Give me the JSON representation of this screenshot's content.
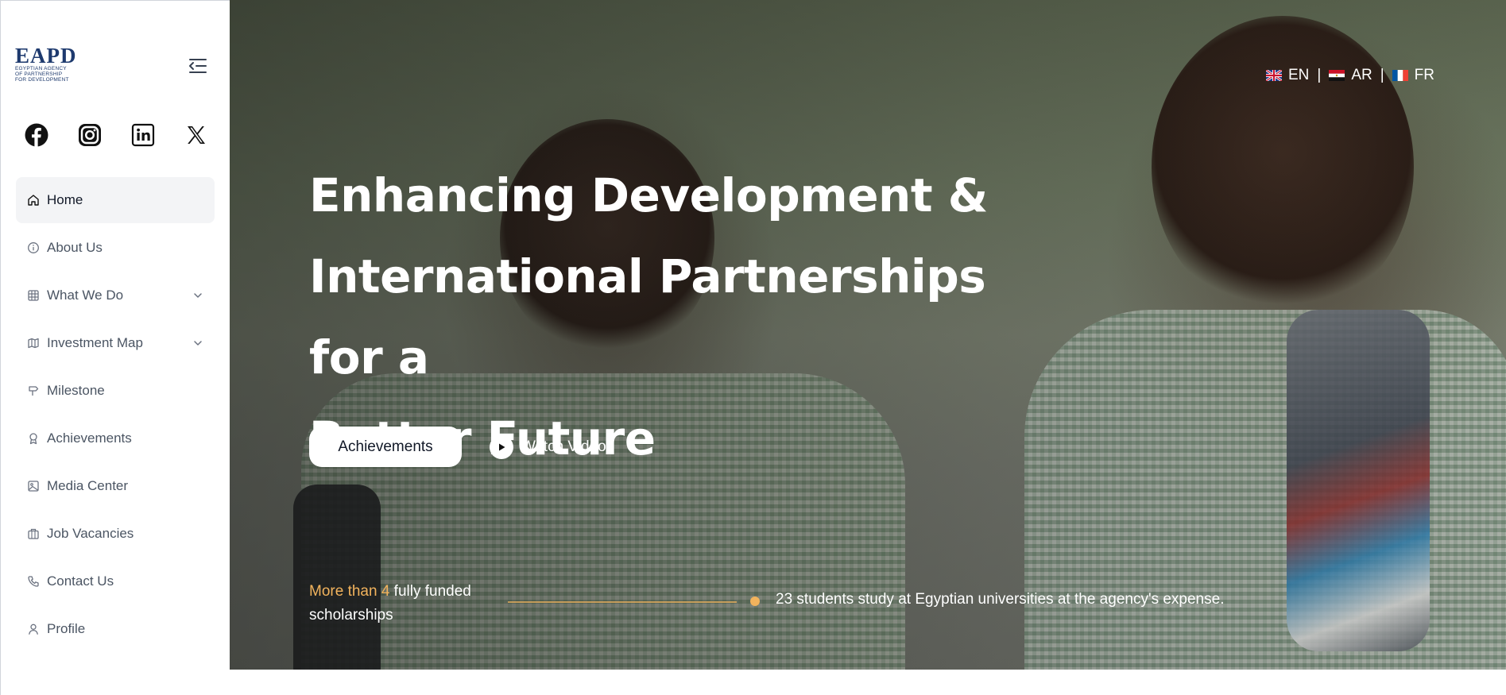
{
  "sidebar": {
    "logo": {
      "mark": "EAPD",
      "sub_lines": [
        "Egyptian Agency",
        "of Partnership",
        "for Development"
      ]
    },
    "socials": [
      "facebook-icon",
      "instagram-icon",
      "linkedin-icon",
      "x-icon"
    ],
    "nav": [
      {
        "label": "Home",
        "icon": "home-icon",
        "active": true
      },
      {
        "label": "About Us",
        "icon": "info-icon"
      },
      {
        "label": "What We Do",
        "icon": "grid-icon",
        "has_submenu": true
      },
      {
        "label": "Investment Map",
        "icon": "map-icon",
        "has_submenu": true
      },
      {
        "label": "Milestone",
        "icon": "signpost-icon"
      },
      {
        "label": "Achievements",
        "icon": "award-icon"
      },
      {
        "label": "Media Center",
        "icon": "image-icon"
      },
      {
        "label": "Job Vacancies",
        "icon": "briefcase-icon"
      },
      {
        "label": "Contact Us",
        "icon": "phone-icon"
      },
      {
        "label": "Profile",
        "icon": "user-icon"
      }
    ]
  },
  "languages": [
    {
      "code": "EN",
      "flag": "uk-flag-icon"
    },
    {
      "code": "AR",
      "flag": "egypt-flag-icon"
    },
    {
      "code": "FR",
      "flag": "france-flag-icon"
    }
  ],
  "hero": {
    "headline_lines": [
      "Enhancing Development &",
      "International Partnerships for a",
      "Better Future"
    ],
    "primary_button": "Achievements",
    "watch_video": "Watch Video",
    "stat_left_highlight": "More than 4",
    "stat_left_rest": " fully funded scholarships",
    "stat_right": "23 students study at Egyptian universities at the agency's expense."
  },
  "colors": {
    "accent": "#f2b35d",
    "brand": "#1e3a6e",
    "active_nav_bg": "#f3f4f6"
  }
}
